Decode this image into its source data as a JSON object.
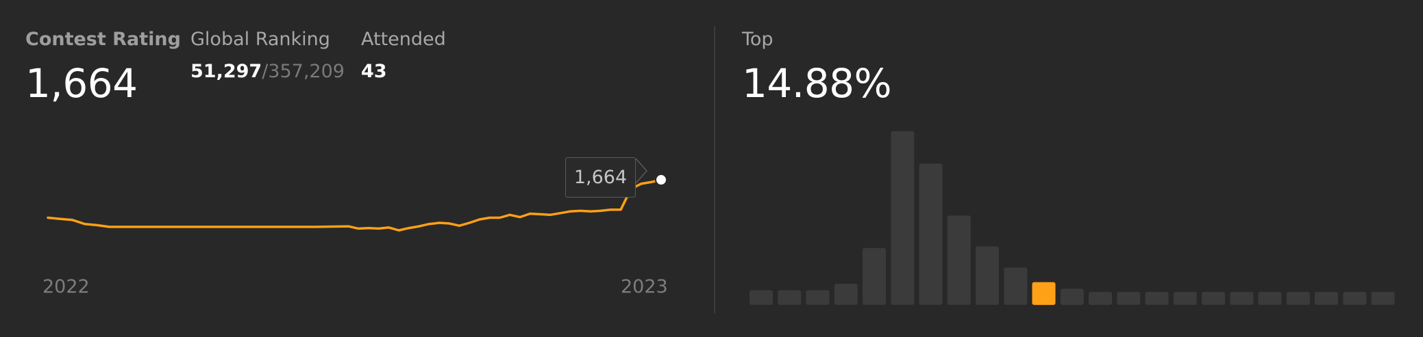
{
  "rating": {
    "label": "Contest Rating",
    "value": "1,664"
  },
  "global_ranking": {
    "label": "Global Ranking",
    "rank": "51,297",
    "total": "/357,209"
  },
  "attended": {
    "label": "Attended",
    "value": "43"
  },
  "top": {
    "label": "Top",
    "value": "14.88%"
  },
  "tooltip": "1,664",
  "colors": {
    "accent": "#ffa116",
    "bar": "#3b3b3b",
    "background": "#282828"
  },
  "chart_data": [
    {
      "type": "line",
      "x_tick_labels": [
        "2022",
        "2023"
      ],
      "series": [
        {
          "values": [
            1598,
            1596,
            1594,
            1587,
            1585,
            1582,
            1582,
            1582,
            1582,
            1582,
            1582,
            1582,
            1582,
            1583,
            1579,
            1580,
            1579,
            1581,
            1576,
            1580,
            1583,
            1587,
            1589,
            1588,
            1584,
            1589,
            1595,
            1598,
            1598,
            1603,
            1599,
            1605,
            1604,
            1603,
            1606,
            1609,
            1610,
            1609,
            1610,
            1612,
            1612,
            1648,
            1657,
            1660,
            1664
          ]
        }
      ],
      "highlight": {
        "value": 1664,
        "label": "1,664"
      }
    },
    {
      "type": "bar",
      "description_level": "rating distribution",
      "values": [
        4.5,
        4.5,
        4.5,
        6.5,
        17.5,
        53.5,
        43.5,
        27.5,
        18,
        11.5,
        7,
        5,
        4,
        4,
        4,
        4,
        4,
        4,
        4,
        4,
        4,
        4,
        4
      ],
      "highlight_index": 10
    }
  ]
}
